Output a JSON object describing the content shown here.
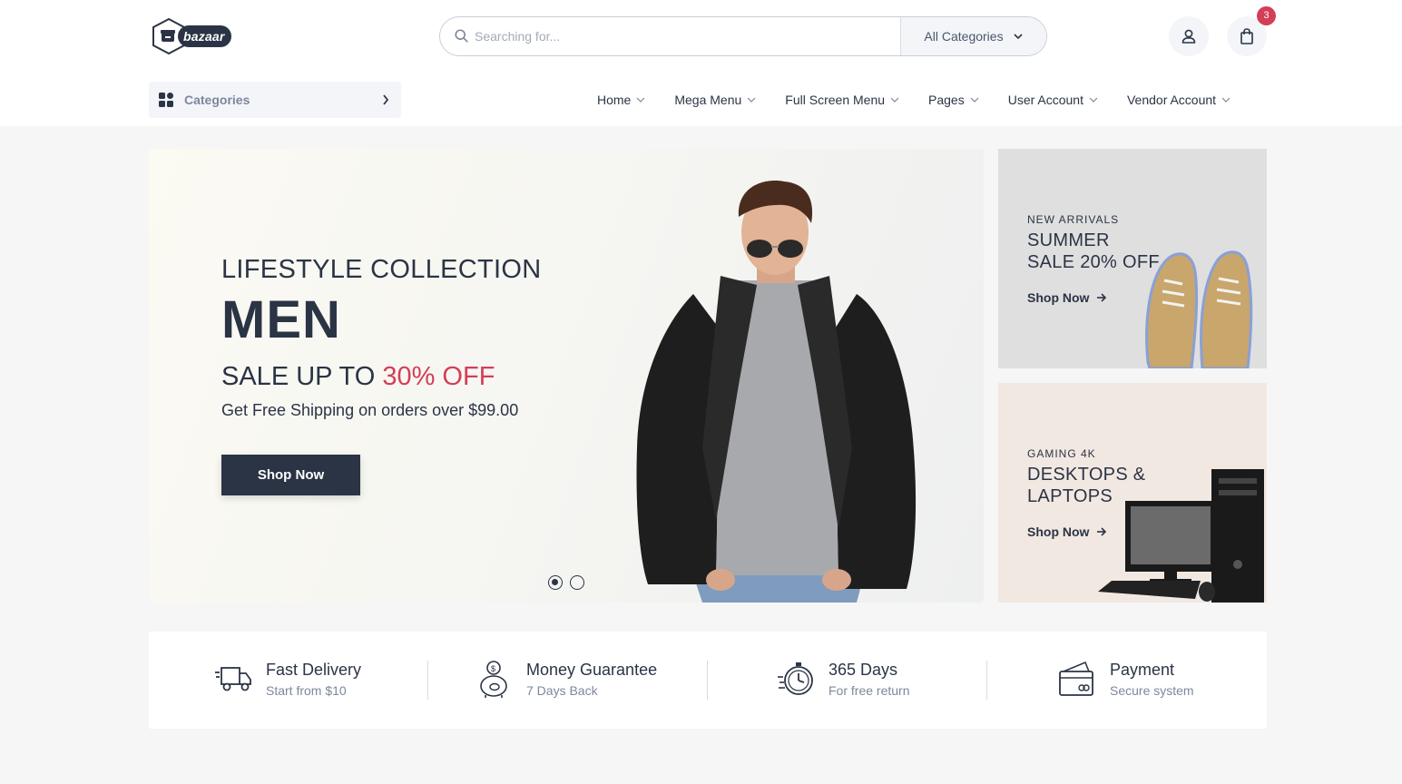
{
  "brand": {
    "name": "bazaar"
  },
  "search": {
    "placeholder": "Searching for...",
    "category": "All Categories"
  },
  "cart": {
    "count": "3"
  },
  "categories_button": {
    "label": "Categories"
  },
  "nav": [
    {
      "label": "Home"
    },
    {
      "label": "Mega Menu"
    },
    {
      "label": "Full Screen Menu"
    },
    {
      "label": "Pages"
    },
    {
      "label": "User Account"
    },
    {
      "label": "Vendor Account"
    }
  ],
  "hero": {
    "subtitle": "LIFESTYLE COLLECTION",
    "title": "MEN",
    "sale_prefix": "SALE UP TO ",
    "sale_accent": "30% OFF",
    "shipping": "Get Free Shipping on orders over $99.00",
    "button": "Shop Now",
    "slides": 2,
    "active_slide": 1
  },
  "banners": [
    {
      "kicker": "NEW ARRIVALS",
      "title_line1": "SUMMER",
      "title_line2": "SALE 20% OFF",
      "link": "Shop Now"
    },
    {
      "kicker": "GAMING 4K",
      "title_line1": "DESKTOPS &",
      "title_line2": "LAPTOPS",
      "link": "Shop Now"
    }
  ],
  "services": [
    {
      "icon": "truck-icon",
      "title": "Fast Delivery",
      "subtitle": "Start from $10"
    },
    {
      "icon": "piggy-bank-icon",
      "title": "Money Guarantee",
      "subtitle": "7 Days Back"
    },
    {
      "icon": "stopwatch-icon",
      "title": "365 Days",
      "subtitle": "For free return"
    },
    {
      "icon": "credit-card-icon",
      "title": "Payment",
      "subtitle": "Secure system"
    }
  ],
  "colors": {
    "primary": "#2b3445",
    "accent": "#d23f57",
    "muted": "#7d879c",
    "banner1": "#dfdfdf",
    "banner2": "#f2e8e2"
  }
}
